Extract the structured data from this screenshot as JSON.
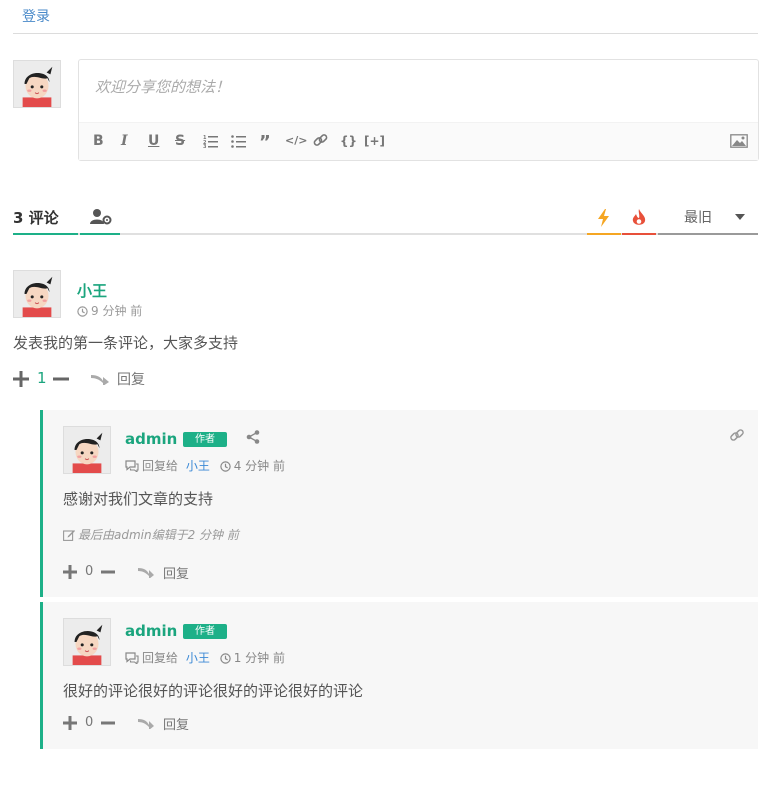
{
  "header": {
    "login_label": "登录"
  },
  "composer": {
    "placeholder": "欢迎分享您的想法！"
  },
  "tabs": {
    "comment_count": "3 评论",
    "sort_label": "最旧"
  },
  "comment": {
    "author": "小王",
    "time": "9 分钟 前",
    "body": "发表我的第一条评论，大家多支持",
    "votes": "1",
    "reply_label": "回复"
  },
  "replies": [
    {
      "author": "admin",
      "badge": "作者",
      "reply_to_label": "回复给",
      "reply_to_name": "小王",
      "time": "4 分钟 前",
      "body": "感谢对我们文章的支持",
      "edited": "最后由admin编辑于2 分钟 前",
      "votes": "0",
      "reply_label": "回复"
    },
    {
      "author": "admin",
      "badge": "作者",
      "reply_to_label": "回复给",
      "reply_to_name": "小王",
      "time": "1 分钟 前",
      "body": "很好的评论很好的评论很好的评论很好的评论",
      "votes": "0",
      "reply_label": "回复"
    }
  ],
  "colors": {
    "accent": "#1db088",
    "author": "#1ba57e",
    "link": "#3d8ad6",
    "hot": "#f5a623",
    "fire": "#e8503a"
  },
  "icons": [
    "image-icon",
    "users-settings-icon",
    "bolt-icon",
    "flame-icon",
    "chevron-down-icon",
    "clock-icon",
    "share-icon",
    "link-icon",
    "chat-icon",
    "edit-icon",
    "plus-icon",
    "minus-icon",
    "reply-arrow-icon"
  ]
}
